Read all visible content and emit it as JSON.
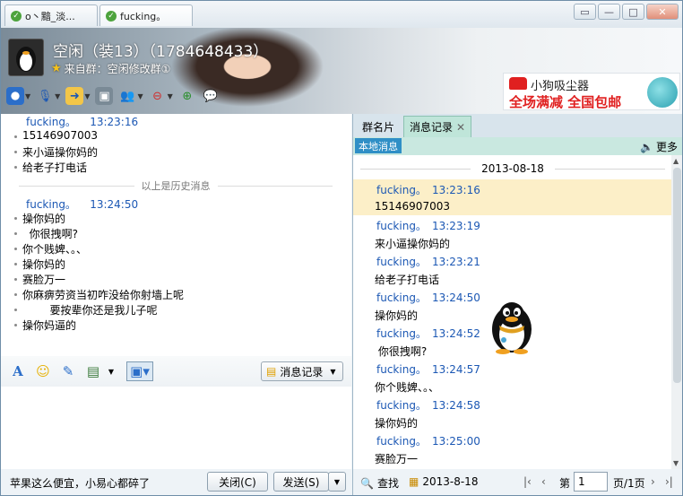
{
  "tabs": [
    {
      "label": "o丶黯_淡..."
    },
    {
      "label": "fucking。"
    }
  ],
  "window_buttons": {
    "restore": "▭",
    "min": "—",
    "max": "□",
    "close": "✕"
  },
  "header": {
    "name": "空闲（装13）（1784648433）",
    "source": "来自群：空闲修改群①"
  },
  "ad": {
    "line1": "小狗吸尘器",
    "line2": "全场满减  全国包邮"
  },
  "left_chat": {
    "first_sender": "fucking。",
    "first_time": "13:23:16",
    "first_lines": [
      "15146907003",
      "来小逼操你妈的",
      "给老子打电话"
    ],
    "history_separator": "以上是历史消息",
    "second_sender": "fucking。",
    "second_time": "13:24:50",
    "second_lines": [
      "操你妈的",
      "  你很拽啊?",
      "你个贱婢、。、",
      "操你妈的",
      "赛脸万一",
      "你麻痹劳资当初咋没给你射墙上呢",
      "        要按辈你还是我儿子呢",
      "操你妈逼的"
    ]
  },
  "format_bar": {
    "history_button": "消息记录"
  },
  "bottom_bar": {
    "tip": "苹果这么便宜，小易心都碎了",
    "close_label": "关闭(C)",
    "send_label": "发送(S)"
  },
  "right_panel": {
    "tab1": "群名片",
    "tab2": "消息记录",
    "local_label": "本地消息",
    "more_label": "更多",
    "date": "2013-08-18",
    "entries": [
      {
        "sender": "fucking。",
        "time": "13:23:16",
        "text": "15146907003"
      },
      {
        "sender": "fucking。",
        "time": "13:23:19",
        "text": "来小逼操你妈的"
      },
      {
        "sender": "fucking。",
        "time": "13:23:21",
        "text": "给老子打电话"
      },
      {
        "sender": "fucking。",
        "time": "13:24:50",
        "text": "操你妈的"
      },
      {
        "sender": "fucking。",
        "time": "13:24:52",
        "text": " 你很拽啊?"
      },
      {
        "sender": "fucking。",
        "time": "13:24:57",
        "text": "你个贱婢、。、"
      },
      {
        "sender": "fucking。",
        "time": "13:24:58",
        "text": "操你妈的"
      },
      {
        "sender": "fucking。",
        "time": "13:25:00",
        "text": "赛脸万一"
      }
    ],
    "search_label": "查找",
    "date_label": "2013-8-18",
    "page_prefix": "第",
    "page_value": "1",
    "page_suffix": "页/1页"
  }
}
